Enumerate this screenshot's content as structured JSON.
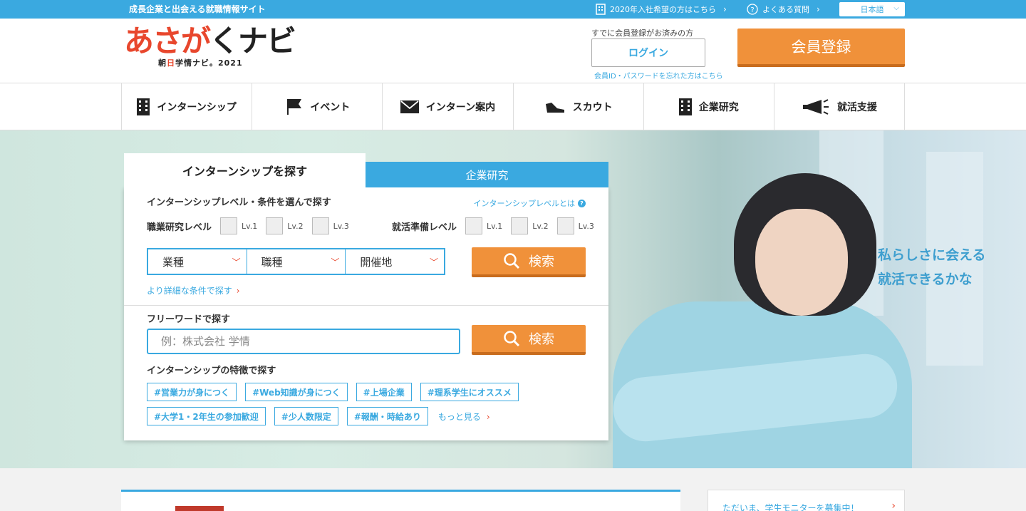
{
  "topbar": {
    "tagline": "成長企業と出会える就職情報サイト",
    "link_2020": "2020年入社希望の方はこちら",
    "link_faq": "よくある質問",
    "language": "日本語"
  },
  "header": {
    "logo_main_red": "あさが",
    "logo_main_dark": "くナビ",
    "logo_sub_prefix": "朝",
    "logo_sub_red": "日",
    "logo_sub_suffix": "学情ナビ。2021",
    "already_registered": "すでに会員登録がお済みの方",
    "login_label": "ログイン",
    "forgot_label": "会員ID・パスワードを忘れた方はこちら",
    "register_label": "会員登録"
  },
  "nav": {
    "items": [
      {
        "label": "インターンシップ",
        "icon": "building-icon"
      },
      {
        "label": "イベント",
        "icon": "flag-icon"
      },
      {
        "label": "インターン案内",
        "icon": "mail-icon"
      },
      {
        "label": "スカウト",
        "icon": "shoe-icon"
      },
      {
        "label": "企業研究",
        "icon": "building-icon"
      },
      {
        "label": "就活支援",
        "icon": "megaphone-icon"
      }
    ]
  },
  "hero": {
    "catch_line1": "私らしさに会える",
    "catch_line2": "就活できるかな"
  },
  "search": {
    "tab_active": "インターンシップを探す",
    "tab_inactive": "企業研究",
    "level_title": "インターンシップレベル・条件を選んで探す",
    "level_help": "インターンシップレベルとは",
    "group1_label": "職業研究レベル",
    "group2_label": "就活準備レベル",
    "levels": [
      "Lv.1",
      "Lv.2",
      "Lv.3"
    ],
    "selects": [
      "業種",
      "職種",
      "開催地"
    ],
    "search_button": "検索",
    "detail_link": "より詳細な条件で探す",
    "freeword_title": "フリーワードで探す",
    "freeword_placeholder": "例：株式会社 学情",
    "feature_title": "インターンシップの特徴で探す",
    "tags": [
      "#営業力が身につく",
      "#Web知識が身につく",
      "#上場企業",
      "#理系学生にオススメ",
      "#大学1・2年生の参加歓迎",
      "#少人数限定",
      "#報酬・時給あり"
    ],
    "more_label": "もっと見る"
  },
  "bottom": {
    "side_text": "ただいま、学生モニターを募集中！"
  },
  "colors": {
    "accent_blue": "#3aa9e0",
    "brand_orange": "#f0913a",
    "brand_red": "#e8472d"
  }
}
